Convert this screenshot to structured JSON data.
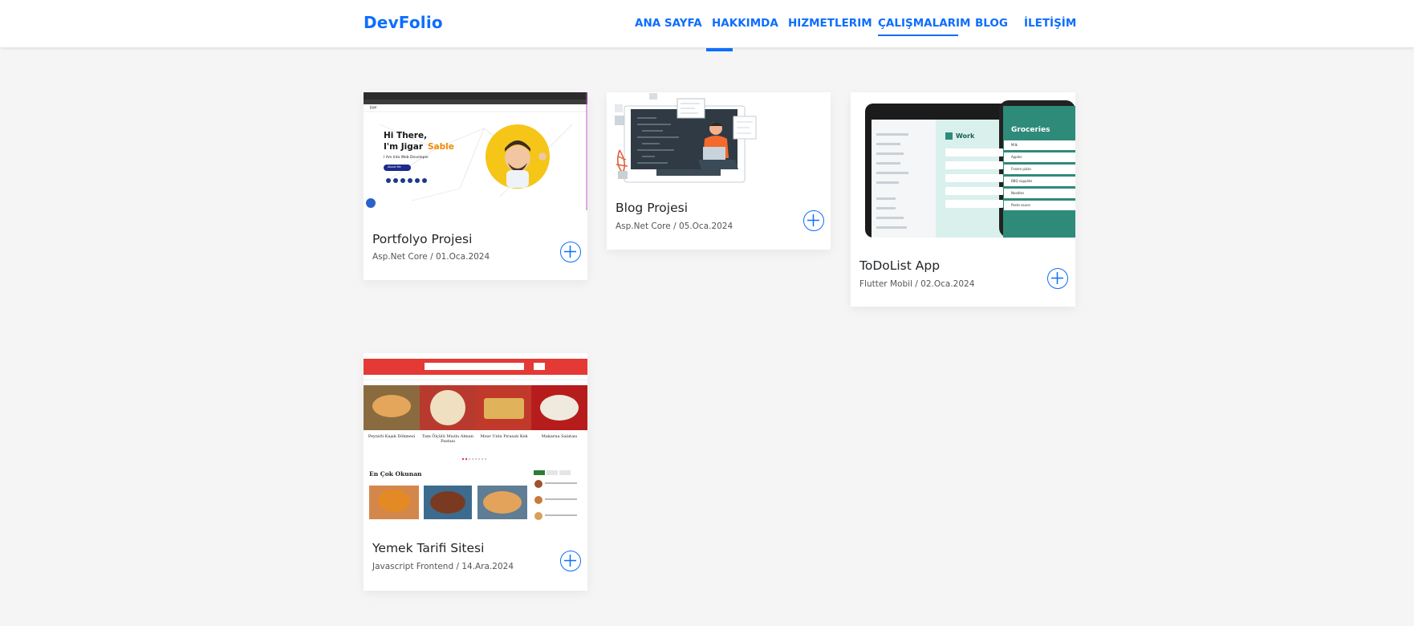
{
  "brand": {
    "name": "DevFolio"
  },
  "nav": {
    "items": [
      "ANA SAYFA",
      "HAKKIMDA",
      "HIZMETLERIM",
      "ÇALIŞMALARIM",
      "BLOG",
      "İLETİŞİM"
    ],
    "active": "ÇALIŞMALARIM"
  },
  "projects": [
    {
      "title": "Portfolyo Projesi",
      "meta": "Asp.Net Core / 01.Oca.2024",
      "thumb": {
        "headline1": "Hi There,",
        "headline2": "I'm Jigar",
        "headline3": "Sable",
        "sub": "I Am Into Web Developer",
        "nav_brand": "Jigar",
        "button": "About Me"
      }
    },
    {
      "title": "Blog Projesi",
      "meta": "Asp.Net Core / 05.Oca.2024"
    },
    {
      "title": "ToDoList App",
      "meta": "Flutter Mobil / 02.Oca.2024",
      "thumb": {
        "tablet_title": "Work",
        "phone_title": "Groceries",
        "phone_items": [
          "Milk",
          "Apples",
          "Frozen pizza",
          "BBQ supplies",
          "Noodles",
          "Pasta sauce"
        ],
        "tablet_sidebar": [
          "Margaret Ochoa",
          "My Day",
          "Important",
          "Planned",
          "Flagged Email",
          "Tasks",
          "Work",
          "Home",
          "Groceries",
          "Shopping list",
          "Books to read"
        ]
      }
    },
    {
      "title": "Yemek Tarifi Sitesi",
      "meta": "Javascript Frontend / 14.Ara.2024",
      "thumb": {
        "foods": [
          "Peynirli Kaşık Dökmesi",
          "Tam Ölçülü Muzlu Alman Pastası",
          "Mısır Unlu Pırasalı Kek",
          "Makarna Salatası"
        ],
        "section": "En Çok Okunan"
      }
    }
  ],
  "colors": {
    "accent": "#0d6efd",
    "background": "#f5f5f5",
    "todo_green": "#2e8b7a",
    "recipe_red": "#e53935"
  }
}
